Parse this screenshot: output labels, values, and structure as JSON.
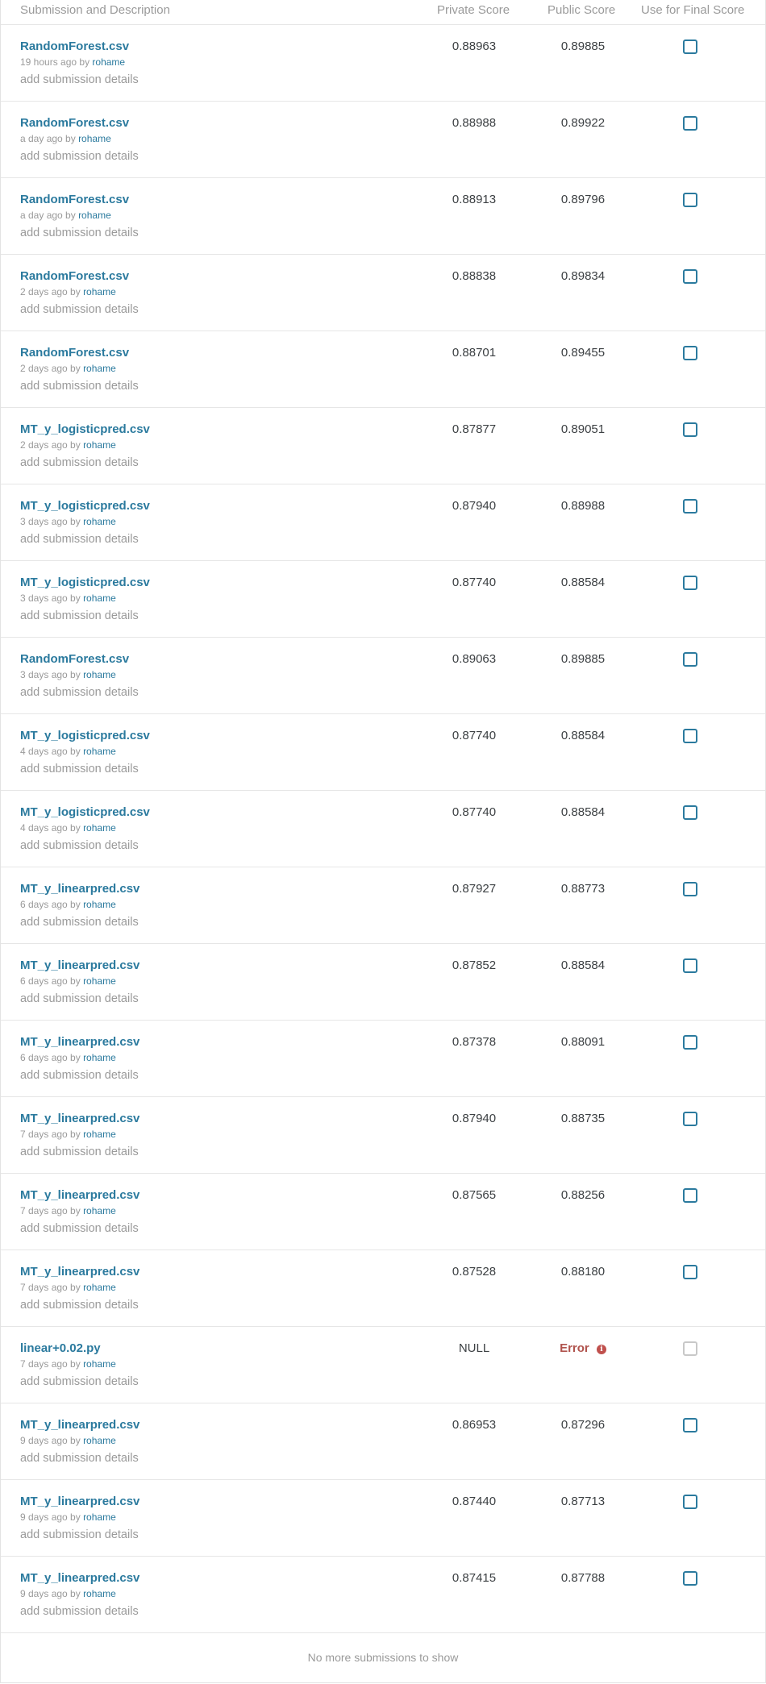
{
  "header": {
    "submission": "Submission and Description",
    "private_score": "Private Score",
    "public_score": "Public Score",
    "final": "Use for Final Score"
  },
  "rows": [
    {
      "name": "RandomForest.csv",
      "time": "19 hours ago by",
      "author": "rohame",
      "details": "add submission details",
      "private": "0.88963",
      "public": "0.89885",
      "error": false
    },
    {
      "name": "RandomForest.csv",
      "time": "a day ago by",
      "author": "rohame",
      "details": "add submission details",
      "private": "0.88988",
      "public": "0.89922",
      "error": false
    },
    {
      "name": "RandomForest.csv",
      "time": "a day ago by",
      "author": "rohame",
      "details": "add submission details",
      "private": "0.88913",
      "public": "0.89796",
      "error": false
    },
    {
      "name": "RandomForest.csv",
      "time": "2 days ago by",
      "author": "rohame",
      "details": "add submission details",
      "private": "0.88838",
      "public": "0.89834",
      "error": false
    },
    {
      "name": "RandomForest.csv",
      "time": "2 days ago by",
      "author": "rohame",
      "details": "add submission details",
      "private": "0.88701",
      "public": "0.89455",
      "error": false
    },
    {
      "name": "MT_y_logisticpred.csv",
      "time": "2 days ago by",
      "author": "rohame",
      "details": "add submission details",
      "private": "0.87877",
      "public": "0.89051",
      "error": false
    },
    {
      "name": "MT_y_logisticpred.csv",
      "time": "3 days ago by",
      "author": "rohame",
      "details": "add submission details",
      "private": "0.87940",
      "public": "0.88988",
      "error": false
    },
    {
      "name": "MT_y_logisticpred.csv",
      "time": "3 days ago by",
      "author": "rohame",
      "details": "add submission details",
      "private": "0.87740",
      "public": "0.88584",
      "error": false
    },
    {
      "name": "RandomForest.csv",
      "time": "3 days ago by",
      "author": "rohame",
      "details": "add submission details",
      "private": "0.89063",
      "public": "0.89885",
      "error": false
    },
    {
      "name": "MT_y_logisticpred.csv",
      "time": "4 days ago by",
      "author": "rohame",
      "details": "add submission details",
      "private": "0.87740",
      "public": "0.88584",
      "error": false
    },
    {
      "name": "MT_y_logisticpred.csv",
      "time": "4 days ago by",
      "author": "rohame",
      "details": "add submission details",
      "private": "0.87740",
      "public": "0.88584",
      "error": false
    },
    {
      "name": "MT_y_linearpred.csv",
      "time": "6 days ago by",
      "author": "rohame",
      "details": "add submission details",
      "private": "0.87927",
      "public": "0.88773",
      "error": false
    },
    {
      "name": "MT_y_linearpred.csv",
      "time": "6 days ago by",
      "author": "rohame",
      "details": "add submission details",
      "private": "0.87852",
      "public": "0.88584",
      "error": false
    },
    {
      "name": "MT_y_linearpred.csv",
      "time": "6 days ago by",
      "author": "rohame",
      "details": "add submission details",
      "private": "0.87378",
      "public": "0.88091",
      "error": false
    },
    {
      "name": "MT_y_linearpred.csv",
      "time": "7 days ago by",
      "author": "rohame",
      "details": "add submission details",
      "private": "0.87940",
      "public": "0.88735",
      "error": false
    },
    {
      "name": "MT_y_linearpred.csv",
      "time": "7 days ago by",
      "author": "rohame",
      "details": "add submission details",
      "private": "0.87565",
      "public": "0.88256",
      "error": false
    },
    {
      "name": "MT_y_linearpred.csv",
      "time": "7 days ago by",
      "author": "rohame",
      "details": "add submission details",
      "private": "0.87528",
      "public": "0.88180",
      "error": false
    },
    {
      "name": "linear+0.02.py",
      "time": "7 days ago by",
      "author": "rohame",
      "details": "add submission details",
      "private": "NULL",
      "public": "Error",
      "error": true
    },
    {
      "name": "MT_y_linearpred.csv",
      "time": "9 days ago by",
      "author": "rohame",
      "details": "add submission details",
      "private": "0.86953",
      "public": "0.87296",
      "error": false
    },
    {
      "name": "MT_y_linearpred.csv",
      "time": "9 days ago by",
      "author": "rohame",
      "details": "add submission details",
      "private": "0.87440",
      "public": "0.87713",
      "error": false
    },
    {
      "name": "MT_y_linearpred.csv",
      "time": "9 days ago by",
      "author": "rohame",
      "details": "add submission details",
      "private": "0.87415",
      "public": "0.87788",
      "error": false
    }
  ],
  "footer": {
    "text": "No more submissions to show"
  },
  "colors": {
    "link": "#2b7a9e",
    "muted": "#9a9a9a",
    "error": "#b0534d",
    "divider": "#e6e6e6"
  },
  "icons": {
    "error": "info-circle-icon",
    "checkbox": "checkbox-icon"
  }
}
